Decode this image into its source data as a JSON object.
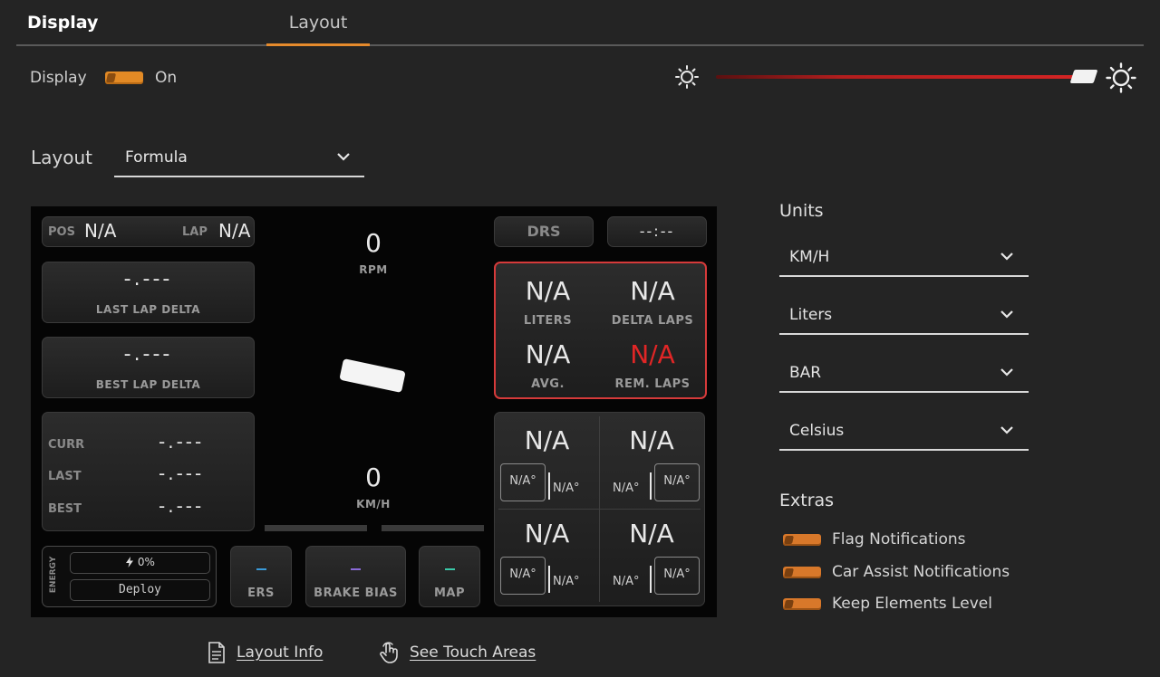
{
  "tabs": {
    "display": "Display",
    "layout": "Layout"
  },
  "display_row": {
    "label": "Display",
    "state": "On"
  },
  "brightness": {
    "level": 0.98
  },
  "layout_select": {
    "label": "Layout",
    "value": "Formula"
  },
  "preview": {
    "pos_label": "POS",
    "pos_value": "N/A",
    "lap_label": "LAP",
    "lap_value": "N/A",
    "rpm_value": "0",
    "rpm_label": "RPM",
    "speed_value": "0",
    "speed_label": "KM/H",
    "drs_label": "DRS",
    "time_value": "--:--",
    "last_lap_delta_value": "-.---",
    "last_lap_delta_label": "LAST LAP DELTA",
    "best_lap_delta_value": "-.---",
    "best_lap_delta_label": "BEST LAP DELTA",
    "curr_label": "CURR",
    "curr_value": "-.---",
    "last_label": "LAST",
    "last_value": "-.---",
    "best_label": "BEST",
    "best_value": "-.---",
    "fuel": {
      "liters_value": "N/A",
      "liters_label": "LITERS",
      "delta_laps_value": "N/A",
      "delta_laps_label": "DELTA LAPS",
      "avg_value": "N/A",
      "avg_label": "AVG.",
      "rem_laps_value": "N/A",
      "rem_laps_label": "REM. LAPS"
    },
    "tyres": {
      "fl_value": "N/A",
      "fl_temp_a": "N/A°",
      "fl_temp_b": "N/A°",
      "fr_value": "N/A",
      "fr_temp_a": "N/A°",
      "fr_temp_b": "N/A°",
      "rl_value": "N/A",
      "rl_temp_a": "N/A°",
      "rl_temp_b": "N/A°",
      "rr_value": "N/A",
      "rr_temp_a": "N/A°",
      "rr_temp_b": "N/A°"
    },
    "energy_label": "ENERGY",
    "energy_value": "0%",
    "deploy_label": "Deploy",
    "ers_label": "ERS",
    "brake_bias_label": "BRAKE BIAS",
    "map_label": "MAP",
    "colors": {
      "fuel_border": "#d63a3a",
      "rem_laps_color": "#e02626",
      "ers": "#3a9ad8",
      "brake_bias": "#8a6ad8",
      "map": "#3ac8a8"
    }
  },
  "units": {
    "title": "Units",
    "speed": "KM/H",
    "volume": "Liters",
    "pressure": "BAR",
    "temperature": "Celsius"
  },
  "extras": {
    "title": "Extras",
    "items": [
      {
        "label": "Flag Notifications"
      },
      {
        "label": "Car Assist Notifications"
      },
      {
        "label": "Keep Elements Level"
      }
    ]
  },
  "links": {
    "layout_info": "Layout Info",
    "touch_areas": "See Touch Areas"
  },
  "icons": {
    "brightness_low": "sun-small-icon",
    "brightness_high": "sun-large-icon",
    "doc": "document-icon",
    "touch": "touch-hand-icon",
    "chevron": "chevron-down-icon"
  },
  "accent": "#e58a2c"
}
